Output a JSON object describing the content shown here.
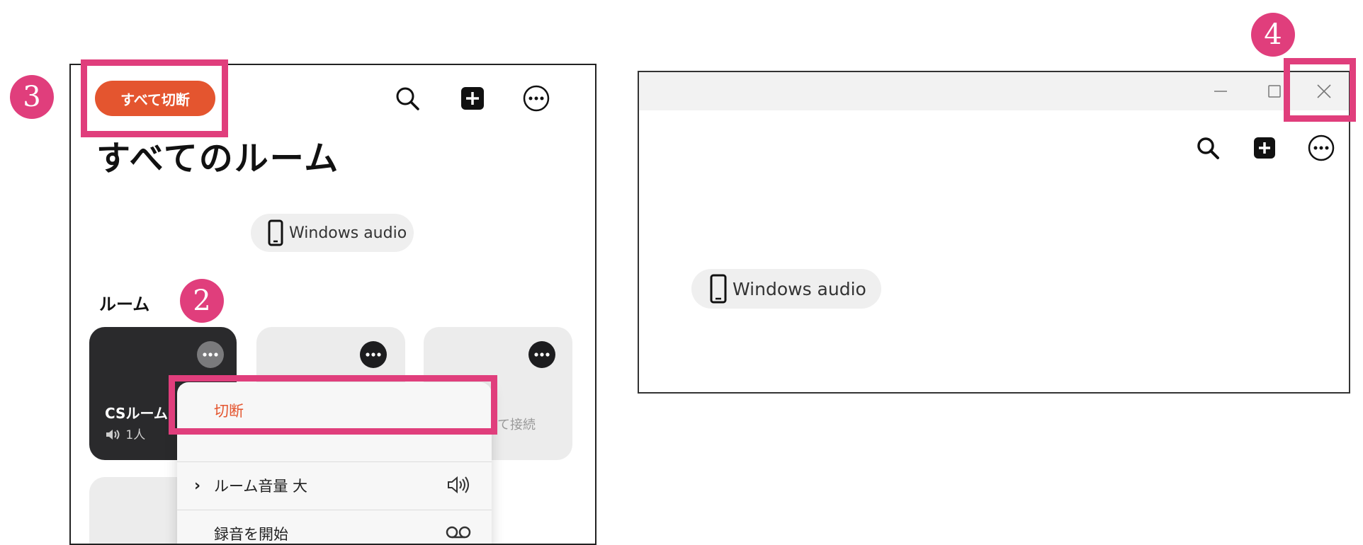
{
  "left_app": {
    "disconnect_all_label": "すべて切断",
    "page_title": "すべてのルーム",
    "device_pill_label": "Windows audio",
    "rooms_section_label": "ルーム",
    "rooms": [
      {
        "name": "CSルーム",
        "sub": "1人",
        "active": true
      },
      {
        "name": "",
        "connect_label": "",
        "active": false
      },
      {
        "name": "",
        "connect_label": "て接続",
        "active": false
      }
    ],
    "context_menu": {
      "items": [
        {
          "label": "切断",
          "color": "#e4552f"
        },
        {
          "label": "ルーム音量 大",
          "has_submenu": true,
          "icon": "speaker-icon"
        },
        {
          "label": "録音を開始",
          "icon": "voicemail-icon"
        }
      ]
    },
    "toolbar_icons": [
      "search-icon",
      "add-square-icon",
      "more-circle-icon"
    ]
  },
  "right_app": {
    "device_pill_label": "Windows audio",
    "window_controls": [
      "minimize-icon",
      "maximize-icon",
      "close-icon"
    ],
    "toolbar_icons": [
      "search-icon",
      "add-square-icon",
      "more-circle-icon"
    ]
  },
  "annotations": {
    "step_2": "2",
    "step_3": "3",
    "step_4": "4",
    "highlight_color": "#e03e7c"
  }
}
